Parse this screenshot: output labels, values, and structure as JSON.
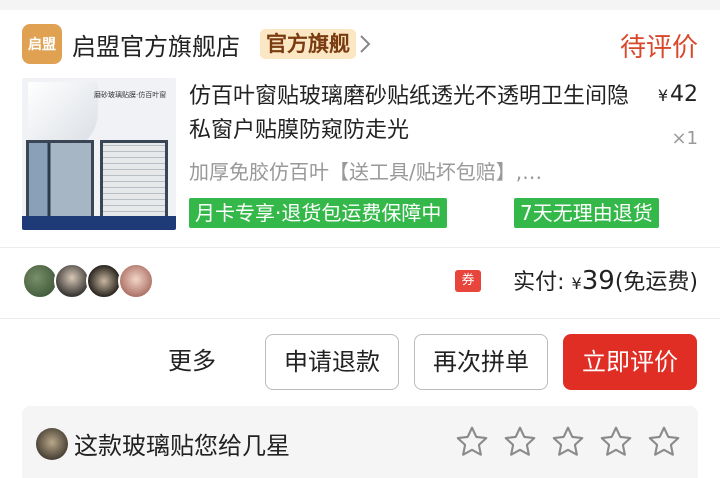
{
  "shop": {
    "logo_text": "启盟",
    "name": "启盟官方旗舰店",
    "badge": "官方旗舰",
    "status": "待评价"
  },
  "product": {
    "title": "仿百叶窗贴玻璃磨砂贴纸透光不透明卫生间隐私窗户贴膜防窥防走光",
    "price_symbol": "¥",
    "price": "42",
    "quantity": "×1",
    "spec": "加厚免胶仿百叶【送工具/贴坏包赔】,…",
    "image_caption": "磨砂玻璃贴膜·仿百叶窗",
    "tags": [
      "月卡专享·退货包运费保障中",
      "7天无理由退货"
    ]
  },
  "payment": {
    "coupon_label": "券",
    "paid_label": "实付:",
    "yen": "¥",
    "amount": "39",
    "shipping": "(免运费)"
  },
  "actions": {
    "more": "更多",
    "refund": "申请退款",
    "rebuy": "再次拼单",
    "review": "立即评价"
  },
  "rating": {
    "prompt": "这款玻璃贴您给几星",
    "stars_total": 5,
    "stars_selected": 0
  },
  "colors": {
    "accent_red": "#e02e24",
    "status_red": "#d9482b",
    "tag_green": "#35b84a",
    "badge_bg": "#fbe7c3"
  },
  "icons": {
    "chevron": "chevron-right-icon",
    "coupon": "coupon-icon",
    "star": "star-outline-icon"
  }
}
